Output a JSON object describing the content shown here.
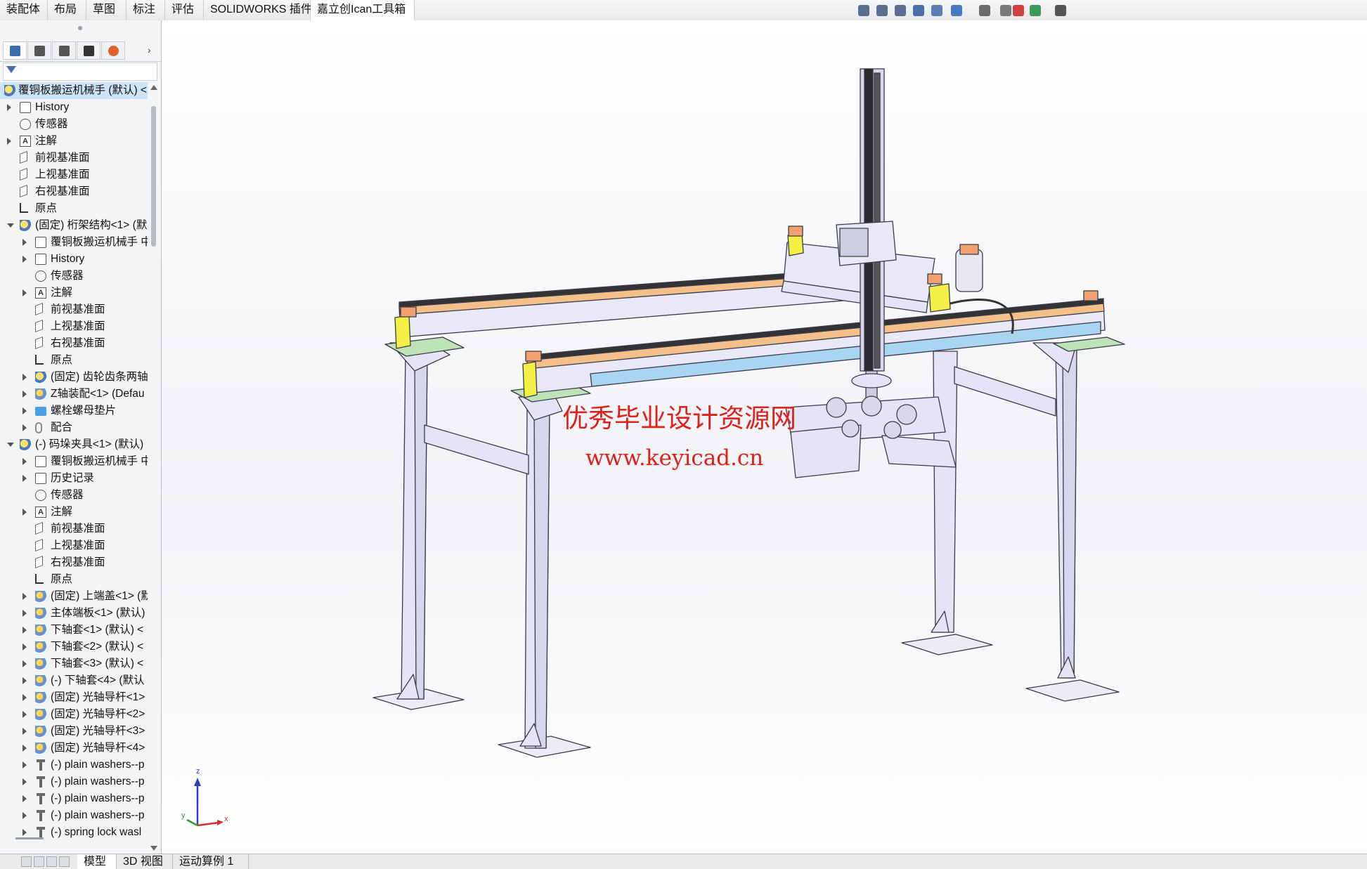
{
  "ribbon_tabs": [
    "装配体",
    "布局",
    "草图",
    "标注",
    "评估",
    "SOLIDWORKS 插件",
    "嘉立创Ican工具箱"
  ],
  "active_ribbon_tab": 6,
  "headsup_icons": [
    "zoom-to-fit-icon",
    "zoom-area-icon",
    "previous-view-icon",
    "section-view-icon",
    "dynamic-annotation-icon",
    "view-orientation-icon",
    "display-style-icon",
    "hide-show-icon",
    "edit-appearance-icon",
    "scene-icon",
    "view-settings-icon"
  ],
  "manager_tabs": [
    "feature-manager-icon",
    "property-manager-icon",
    "configuration-manager-icon",
    "dimxpert-icon",
    "display-manager-icon"
  ],
  "tree": [
    {
      "label": "覆铜板搬运机械手 (默认) <默",
      "indent": 0,
      "arrow": "",
      "icon": "asm",
      "hl": true
    },
    {
      "label": "History",
      "indent": 0,
      "arrow": "r",
      "icon": "hist"
    },
    {
      "label": "传感器",
      "indent": 0,
      "arrow": "",
      "icon": "sensor"
    },
    {
      "label": "注解",
      "indent": 0,
      "arrow": "r",
      "icon": "anno"
    },
    {
      "label": "前视基准面",
      "indent": 0,
      "arrow": "",
      "icon": "plane"
    },
    {
      "label": "上视基准面",
      "indent": 0,
      "arrow": "",
      "icon": "plane"
    },
    {
      "label": "右视基准面",
      "indent": 0,
      "arrow": "",
      "icon": "plane"
    },
    {
      "label": "原点",
      "indent": 0,
      "arrow": "",
      "icon": "origin"
    },
    {
      "label": "(固定) 桁架结构<1> (默",
      "indent": 0,
      "arrow": "d",
      "icon": "asm"
    },
    {
      "label": "覆铜板搬运机械手 中",
      "indent": 1,
      "arrow": "r",
      "icon": "hist"
    },
    {
      "label": "History",
      "indent": 1,
      "arrow": "r",
      "icon": "hist"
    },
    {
      "label": "传感器",
      "indent": 1,
      "arrow": "",
      "icon": "sensor"
    },
    {
      "label": "注解",
      "indent": 1,
      "arrow": "r",
      "icon": "anno"
    },
    {
      "label": "前视基准面",
      "indent": 1,
      "arrow": "",
      "icon": "plane"
    },
    {
      "label": "上视基准面",
      "indent": 1,
      "arrow": "",
      "icon": "plane"
    },
    {
      "label": "右视基准面",
      "indent": 1,
      "arrow": "",
      "icon": "plane"
    },
    {
      "label": "原点",
      "indent": 1,
      "arrow": "",
      "icon": "origin"
    },
    {
      "label": "(固定) 齿轮齿条两轴",
      "indent": 1,
      "arrow": "r",
      "icon": "asm"
    },
    {
      "label": "Z轴装配<1> (Defau",
      "indent": 1,
      "arrow": "r",
      "icon": "part"
    },
    {
      "label": "螺栓螺母垫片",
      "indent": 1,
      "arrow": "r",
      "icon": "folder"
    },
    {
      "label": "配合",
      "indent": 1,
      "arrow": "r",
      "icon": "mate"
    },
    {
      "label": "(-) 码垛夹具<1> (默认)",
      "indent": 0,
      "arrow": "d",
      "icon": "asm"
    },
    {
      "label": "覆铜板搬运机械手 中",
      "indent": 1,
      "arrow": "r",
      "icon": "hist"
    },
    {
      "label": "历史记录",
      "indent": 1,
      "arrow": "r",
      "icon": "hist"
    },
    {
      "label": "传感器",
      "indent": 1,
      "arrow": "",
      "icon": "sensor"
    },
    {
      "label": "注解",
      "indent": 1,
      "arrow": "r",
      "icon": "anno"
    },
    {
      "label": "前视基准面",
      "indent": 1,
      "arrow": "",
      "icon": "plane"
    },
    {
      "label": "上视基准面",
      "indent": 1,
      "arrow": "",
      "icon": "plane"
    },
    {
      "label": "右视基准面",
      "indent": 1,
      "arrow": "",
      "icon": "plane"
    },
    {
      "label": "原点",
      "indent": 1,
      "arrow": "",
      "icon": "origin"
    },
    {
      "label": "(固定) 上端盖<1> (默",
      "indent": 1,
      "arrow": "r",
      "icon": "part"
    },
    {
      "label": "主体端板<1> (默认)",
      "indent": 1,
      "arrow": "r",
      "icon": "part"
    },
    {
      "label": "下轴套<1> (默认) <",
      "indent": 1,
      "arrow": "r",
      "icon": "part"
    },
    {
      "label": "下轴套<2> (默认) <",
      "indent": 1,
      "arrow": "r",
      "icon": "part"
    },
    {
      "label": "下轴套<3> (默认) <",
      "indent": 1,
      "arrow": "r",
      "icon": "part"
    },
    {
      "label": "(-) 下轴套<4> (默认",
      "indent": 1,
      "arrow": "r",
      "icon": "part"
    },
    {
      "label": "(固定) 光轴导杆<1>",
      "indent": 1,
      "arrow": "r",
      "icon": "part"
    },
    {
      "label": "(固定) 光轴导杆<2>",
      "indent": 1,
      "arrow": "r",
      "icon": "part"
    },
    {
      "label": "(固定) 光轴导杆<3>",
      "indent": 1,
      "arrow": "r",
      "icon": "part"
    },
    {
      "label": "(固定) 光轴导杆<4>",
      "indent": 1,
      "arrow": "r",
      "icon": "part"
    },
    {
      "label": "(-) plain washers--p",
      "indent": 1,
      "arrow": "r",
      "icon": "screw"
    },
    {
      "label": "(-) plain washers--p",
      "indent": 1,
      "arrow": "r",
      "icon": "screw"
    },
    {
      "label": "(-) plain washers--p",
      "indent": 1,
      "arrow": "r",
      "icon": "screw"
    },
    {
      "label": "(-) plain washers--p",
      "indent": 1,
      "arrow": "r",
      "icon": "screw"
    },
    {
      "label": "(-) spring lock wasl",
      "indent": 1,
      "arrow": "r",
      "icon": "screw"
    }
  ],
  "watermark": {
    "line1": "优秀毕业设计资源网",
    "line2": "www.keyicad.cn"
  },
  "triad": {
    "x": "x",
    "y": "y",
    "z": "z"
  },
  "bottom_tabs": [
    "模型",
    "3D 视图",
    "运动算例 1"
  ],
  "active_bottom_tab": 0,
  "colors": {
    "frame": "#e4e4f6",
    "rail_orange": "#f3c08a",
    "rail_blue": "#a9d4f2",
    "yellow_block": "#f3ef45",
    "green_pad": "#bfe3b8",
    "watermark": "#e0201c"
  }
}
